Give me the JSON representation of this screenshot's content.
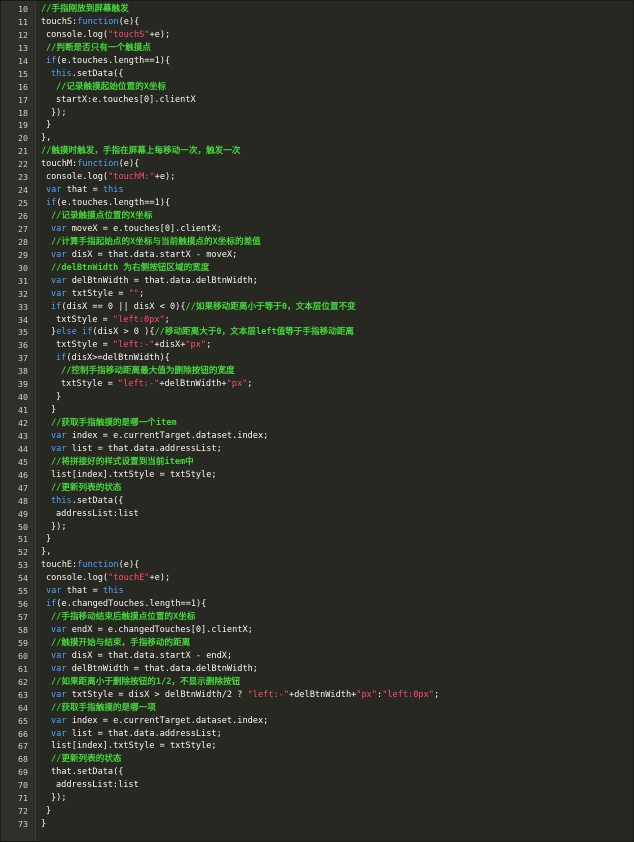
{
  "editor": {
    "colors": {
      "background": "#272822",
      "gutter": "#2f3029",
      "text": "#f8f8f2",
      "comment": "#44d83a",
      "keyword": "#4da3ff",
      "string": "#ff4d6b",
      "line_number": "#d0d0c8"
    },
    "lines": [
      {
        "n": "10",
        "indent": 1,
        "tokens": [
          {
            "t": "comment",
            "v": "//手指刚放到屏幕触发"
          }
        ]
      },
      {
        "n": "11",
        "indent": 1,
        "tokens": [
          {
            "t": "plain",
            "v": "touchS:"
          },
          {
            "t": "keyword",
            "v": "function"
          },
          {
            "t": "plain",
            "v": "(e){"
          }
        ]
      },
      {
        "n": "12",
        "indent": 2,
        "tokens": [
          {
            "t": "plain",
            "v": "console.log("
          },
          {
            "t": "string",
            "v": "\"touchS\""
          },
          {
            "t": "plain",
            "v": "+e);"
          }
        ]
      },
      {
        "n": "13",
        "indent": 2,
        "tokens": [
          {
            "t": "comment",
            "v": "//判断是否只有一个触摸点"
          }
        ]
      },
      {
        "n": "14",
        "indent": 2,
        "tokens": [
          {
            "t": "keyword",
            "v": "if"
          },
          {
            "t": "plain",
            "v": "(e.touches.length==1){"
          }
        ]
      },
      {
        "n": "15",
        "indent": 3,
        "tokens": [
          {
            "t": "keyword",
            "v": "this"
          },
          {
            "t": "plain",
            "v": ".setData({"
          }
        ]
      },
      {
        "n": "16",
        "indent": 4,
        "tokens": [
          {
            "t": "comment",
            "v": "//记录触摸起始位置的X坐标"
          }
        ]
      },
      {
        "n": "17",
        "indent": 4,
        "tokens": [
          {
            "t": "plain",
            "v": "startX:e.touches[0].clientX"
          }
        ]
      },
      {
        "n": "18",
        "indent": 3,
        "tokens": [
          {
            "t": "plain",
            "v": "});"
          }
        ]
      },
      {
        "n": "19",
        "indent": 2,
        "tokens": [
          {
            "t": "plain",
            "v": "}"
          }
        ]
      },
      {
        "n": "20",
        "indent": 1,
        "tokens": [
          {
            "t": "plain",
            "v": "},"
          }
        ]
      },
      {
        "n": "21",
        "indent": 1,
        "tokens": [
          {
            "t": "comment",
            "v": "//触摸时触发，手指在屏幕上每移动一次，触发一次"
          }
        ]
      },
      {
        "n": "22",
        "indent": 1,
        "tokens": [
          {
            "t": "plain",
            "v": "touchM:"
          },
          {
            "t": "keyword",
            "v": "function"
          },
          {
            "t": "plain",
            "v": "(e){"
          }
        ]
      },
      {
        "n": "23",
        "indent": 2,
        "tokens": [
          {
            "t": "plain",
            "v": "console.log("
          },
          {
            "t": "string",
            "v": "\"touchM:\""
          },
          {
            "t": "plain",
            "v": "+e);"
          }
        ]
      },
      {
        "n": "24",
        "indent": 2,
        "tokens": [
          {
            "t": "keyword",
            "v": "var"
          },
          {
            "t": "plain",
            "v": " that = "
          },
          {
            "t": "keyword",
            "v": "this"
          }
        ]
      },
      {
        "n": "25",
        "indent": 2,
        "tokens": [
          {
            "t": "keyword",
            "v": "if"
          },
          {
            "t": "plain",
            "v": "(e.touches.length==1){"
          }
        ]
      },
      {
        "n": "26",
        "indent": 3,
        "tokens": [
          {
            "t": "comment",
            "v": "//记录触摸点位置的X坐标"
          }
        ]
      },
      {
        "n": "27",
        "indent": 3,
        "tokens": [
          {
            "t": "keyword",
            "v": "var"
          },
          {
            "t": "plain",
            "v": " moveX = e.touches[0].clientX;"
          }
        ]
      },
      {
        "n": "28",
        "indent": 3,
        "tokens": [
          {
            "t": "comment",
            "v": "//计算手指起始点的X坐标与当前触摸点的X坐标的差值"
          }
        ]
      },
      {
        "n": "29",
        "indent": 3,
        "tokens": [
          {
            "t": "keyword",
            "v": "var"
          },
          {
            "t": "plain",
            "v": " disX = that.data.startX - moveX;"
          }
        ]
      },
      {
        "n": "30",
        "indent": 3,
        "tokens": [
          {
            "t": "comment",
            "v": "//delBtnWidth 为右侧按钮区域的宽度"
          }
        ]
      },
      {
        "n": "31",
        "indent": 3,
        "tokens": [
          {
            "t": "keyword",
            "v": "var"
          },
          {
            "t": "plain",
            "v": " delBtnWidth = that.data.delBtnWidth;"
          }
        ]
      },
      {
        "n": "32",
        "indent": 3,
        "tokens": [
          {
            "t": "keyword",
            "v": "var"
          },
          {
            "t": "plain",
            "v": " txtStyle = "
          },
          {
            "t": "string",
            "v": "\"\""
          },
          {
            "t": "plain",
            "v": ";"
          }
        ]
      },
      {
        "n": "33",
        "indent": 3,
        "tokens": [
          {
            "t": "keyword",
            "v": "if"
          },
          {
            "t": "plain",
            "v": "(disX == 0 || disX < 0){"
          },
          {
            "t": "comment",
            "v": "//如果移动距离小于等于0，文本层位置不变"
          }
        ]
      },
      {
        "n": "34",
        "indent": 4,
        "tokens": [
          {
            "t": "plain",
            "v": "txtStyle = "
          },
          {
            "t": "string",
            "v": "\"left:0px\""
          },
          {
            "t": "plain",
            "v": ";"
          }
        ]
      },
      {
        "n": "35",
        "indent": 3,
        "tokens": [
          {
            "t": "plain",
            "v": "}"
          },
          {
            "t": "keyword",
            "v": "else if"
          },
          {
            "t": "plain",
            "v": "(disX > 0 ){"
          },
          {
            "t": "comment",
            "v": "//移动距离大于0，文本层left值等于手指移动距离"
          }
        ]
      },
      {
        "n": "36",
        "indent": 4,
        "tokens": [
          {
            "t": "plain",
            "v": "txtStyle = "
          },
          {
            "t": "string",
            "v": "\"left:-\""
          },
          {
            "t": "plain",
            "v": "+disX+"
          },
          {
            "t": "string",
            "v": "\"px\""
          },
          {
            "t": "plain",
            "v": ";"
          }
        ]
      },
      {
        "n": "37",
        "indent": 4,
        "tokens": [
          {
            "t": "keyword",
            "v": "if"
          },
          {
            "t": "plain",
            "v": "(disX>=delBtnWidth){"
          }
        ]
      },
      {
        "n": "38",
        "indent": 5,
        "tokens": [
          {
            "t": "comment",
            "v": "//控制手指移动距离最大值为删除按钮的宽度"
          }
        ]
      },
      {
        "n": "39",
        "indent": 5,
        "tokens": [
          {
            "t": "plain",
            "v": "txtStyle = "
          },
          {
            "t": "string",
            "v": "\"left:-\""
          },
          {
            "t": "plain",
            "v": "+delBtnWidth+"
          },
          {
            "t": "string",
            "v": "\"px\""
          },
          {
            "t": "plain",
            "v": ";"
          }
        ]
      },
      {
        "n": "40",
        "indent": 4,
        "tokens": [
          {
            "t": "plain",
            "v": "}"
          }
        ]
      },
      {
        "n": "41",
        "indent": 3,
        "tokens": [
          {
            "t": "plain",
            "v": "}"
          }
        ]
      },
      {
        "n": "42",
        "indent": 3,
        "tokens": [
          {
            "t": "comment",
            "v": "//获取手指触摸的是哪一个item"
          }
        ]
      },
      {
        "n": "43",
        "indent": 3,
        "tokens": [
          {
            "t": "keyword",
            "v": "var"
          },
          {
            "t": "plain",
            "v": " index = e.currentTarget.dataset.index;"
          }
        ]
      },
      {
        "n": "44",
        "indent": 3,
        "tokens": [
          {
            "t": "keyword",
            "v": "var"
          },
          {
            "t": "plain",
            "v": " list = that.data.addressList;"
          }
        ]
      },
      {
        "n": "45",
        "indent": 3,
        "tokens": [
          {
            "t": "comment",
            "v": "//将拼接好的样式设置到当前item中"
          }
        ]
      },
      {
        "n": "46",
        "indent": 3,
        "tokens": [
          {
            "t": "plain",
            "v": "list[index].txtStyle = txtStyle;"
          }
        ]
      },
      {
        "n": "47",
        "indent": 3,
        "tokens": [
          {
            "t": "comment",
            "v": "//更新列表的状态"
          }
        ]
      },
      {
        "n": "48",
        "indent": 3,
        "tokens": [
          {
            "t": "keyword",
            "v": "this"
          },
          {
            "t": "plain",
            "v": ".setData({"
          }
        ]
      },
      {
        "n": "49",
        "indent": 4,
        "tokens": [
          {
            "t": "plain",
            "v": "addressList:list"
          }
        ]
      },
      {
        "n": "50",
        "indent": 3,
        "tokens": [
          {
            "t": "plain",
            "v": "});"
          }
        ]
      },
      {
        "n": "51",
        "indent": 2,
        "tokens": [
          {
            "t": "plain",
            "v": "}"
          }
        ]
      },
      {
        "n": "52",
        "indent": 1,
        "tokens": [
          {
            "t": "plain",
            "v": "},"
          }
        ]
      },
      {
        "n": "53",
        "indent": 1,
        "tokens": [
          {
            "t": "plain",
            "v": "touchE:"
          },
          {
            "t": "keyword",
            "v": "function"
          },
          {
            "t": "plain",
            "v": "(e){"
          }
        ]
      },
      {
        "n": "54",
        "indent": 2,
        "tokens": [
          {
            "t": "plain",
            "v": "console.log("
          },
          {
            "t": "string",
            "v": "\"touchE\""
          },
          {
            "t": "plain",
            "v": "+e);"
          }
        ]
      },
      {
        "n": "55",
        "indent": 2,
        "tokens": [
          {
            "t": "keyword",
            "v": "var"
          },
          {
            "t": "plain",
            "v": " that = "
          },
          {
            "t": "keyword",
            "v": "this"
          }
        ]
      },
      {
        "n": "56",
        "indent": 2,
        "tokens": [
          {
            "t": "keyword",
            "v": "if"
          },
          {
            "t": "plain",
            "v": "(e.changedTouches.length==1){"
          }
        ]
      },
      {
        "n": "57",
        "indent": 3,
        "tokens": [
          {
            "t": "comment",
            "v": "//手指移动结束后触摸点位置的X坐标"
          }
        ]
      },
      {
        "n": "58",
        "indent": 3,
        "tokens": [
          {
            "t": "keyword",
            "v": "var"
          },
          {
            "t": "plain",
            "v": " endX = e.changedTouches[0].clientX;"
          }
        ]
      },
      {
        "n": "59",
        "indent": 3,
        "tokens": [
          {
            "t": "comment",
            "v": "//触摸开始与结束，手指移动的距离"
          }
        ]
      },
      {
        "n": "60",
        "indent": 3,
        "tokens": [
          {
            "t": "keyword",
            "v": "var"
          },
          {
            "t": "plain",
            "v": " disX = that.data.startX - endX;"
          }
        ]
      },
      {
        "n": "61",
        "indent": 3,
        "tokens": [
          {
            "t": "keyword",
            "v": "var"
          },
          {
            "t": "plain",
            "v": " delBtnWidth = that.data.delBtnWidth;"
          }
        ]
      },
      {
        "n": "62",
        "indent": 3,
        "tokens": [
          {
            "t": "comment",
            "v": "//如果距离小于删除按钮的1/2，不显示删除按钮"
          }
        ]
      },
      {
        "n": "63",
        "indent": 3,
        "tokens": [
          {
            "t": "keyword",
            "v": "var"
          },
          {
            "t": "plain",
            "v": " txtStyle = disX > delBtnWidth/2 ? "
          },
          {
            "t": "string",
            "v": "\"left:-\""
          },
          {
            "t": "plain",
            "v": "+delBtnWidth+"
          },
          {
            "t": "string",
            "v": "\"px\""
          },
          {
            "t": "plain",
            "v": ":"
          },
          {
            "t": "string",
            "v": "\"left:0px\""
          },
          {
            "t": "plain",
            "v": ";"
          }
        ]
      },
      {
        "n": "64",
        "indent": 3,
        "tokens": [
          {
            "t": "comment",
            "v": "//获取手指触摸的是哪一项"
          }
        ]
      },
      {
        "n": "65",
        "indent": 3,
        "tokens": [
          {
            "t": "keyword",
            "v": "var"
          },
          {
            "t": "plain",
            "v": " index = e.currentTarget.dataset.index;"
          }
        ]
      },
      {
        "n": "66",
        "indent": 3,
        "tokens": [
          {
            "t": "keyword",
            "v": "var"
          },
          {
            "t": "plain",
            "v": " list = that.data.addressList;"
          }
        ]
      },
      {
        "n": "67",
        "indent": 3,
        "tokens": [
          {
            "t": "plain",
            "v": "list[index].txtStyle = txtStyle;"
          }
        ]
      },
      {
        "n": "68",
        "indent": 3,
        "tokens": [
          {
            "t": "comment",
            "v": "//更新列表的状态"
          }
        ]
      },
      {
        "n": "69",
        "indent": 3,
        "tokens": [
          {
            "t": "plain",
            "v": "that.setData({"
          }
        ]
      },
      {
        "n": "70",
        "indent": 4,
        "tokens": [
          {
            "t": "plain",
            "v": "addressList:list"
          }
        ]
      },
      {
        "n": "71",
        "indent": 3,
        "tokens": [
          {
            "t": "plain",
            "v": "});"
          }
        ]
      },
      {
        "n": "72",
        "indent": 2,
        "tokens": [
          {
            "t": "plain",
            "v": "}"
          }
        ]
      },
      {
        "n": "73",
        "indent": 1,
        "tokens": [
          {
            "t": "plain",
            "v": "}"
          }
        ]
      }
    ]
  }
}
